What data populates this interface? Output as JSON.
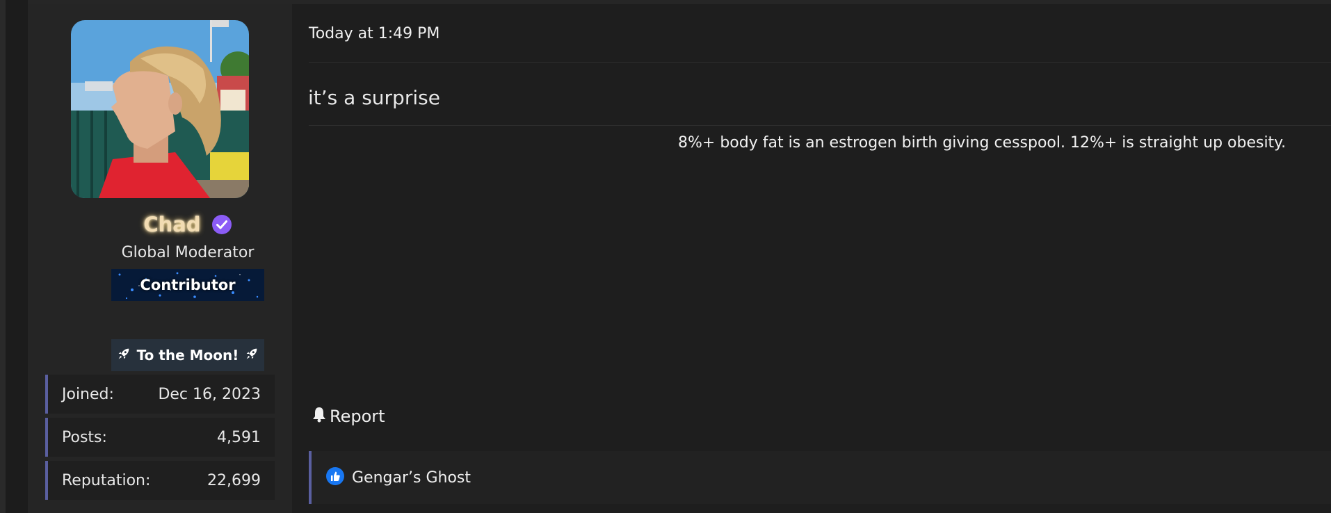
{
  "user": {
    "name": "Chad",
    "title": "Global Moderator",
    "banner_label": "Contributor",
    "badge_label": "To the Moon!",
    "stats": [
      {
        "label": "Joined:",
        "value": "Dec 16, 2023"
      },
      {
        "label": "Posts:",
        "value": "4,591"
      },
      {
        "label": "Reputation:",
        "value": "22,699"
      }
    ]
  },
  "post": {
    "date": "Today at 1:49 PM",
    "message": "it’s a surprise",
    "signature": "8%+ body fat is an estrogen birth giving cesspool. 12%+ is straight up obesity.",
    "report_label": "Report",
    "reaction_user": "Gengar’s Ghost"
  },
  "colors": {
    "accent": "#5a5fa0",
    "verified": "#8b5cf6",
    "username_glow": "#f5d27a",
    "like_blue": "#1877f2"
  },
  "icons": {
    "verified": "verified-badge-icon",
    "rocket": "rocket-icon",
    "report": "bell-icon",
    "reaction": "thumbs-up-icon"
  }
}
